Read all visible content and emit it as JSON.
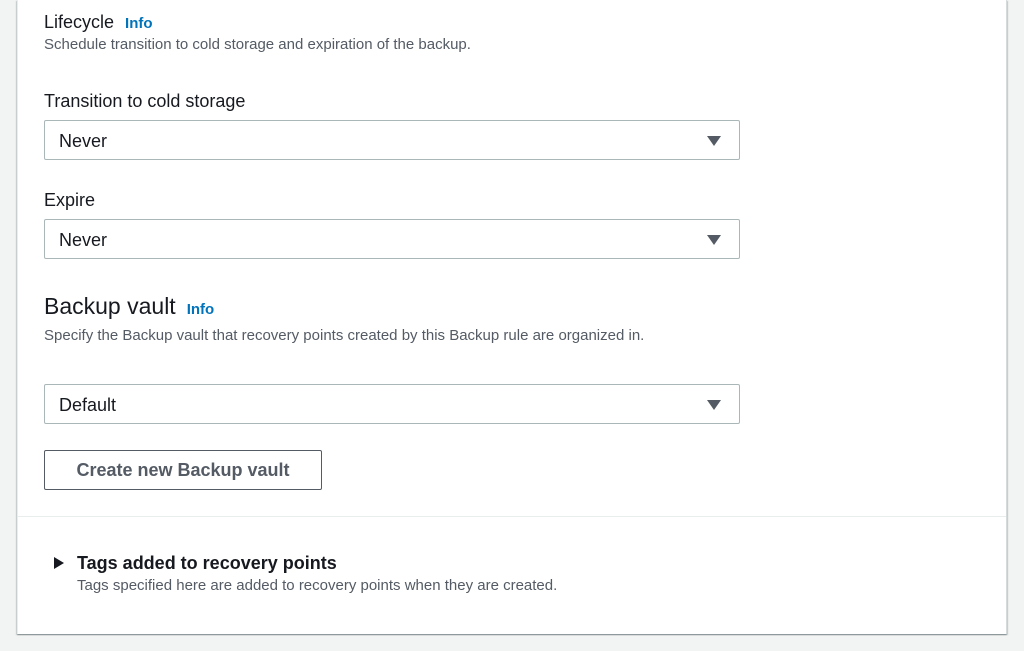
{
  "lifecycle": {
    "title": "Lifecycle",
    "info_label": "Info",
    "description": "Schedule transition to cold storage and expiration of the backup.",
    "transition": {
      "label": "Transition to cold storage",
      "value": "Never"
    },
    "expire": {
      "label": "Expire",
      "value": "Never"
    }
  },
  "backup_vault": {
    "title": "Backup vault",
    "info_label": "Info",
    "description": "Specify the Backup vault that recovery points created by this Backup rule are organized in.",
    "value": "Default",
    "create_button_label": "Create new Backup vault"
  },
  "tags": {
    "title": "Tags added to recovery points",
    "description": "Tags specified here are added to recovery points when they are created."
  },
  "colors": {
    "link": "#0073bb",
    "text": "#16191f",
    "muted": "#545b64",
    "border": "#aab7b8",
    "background": "#f2f3f3"
  }
}
